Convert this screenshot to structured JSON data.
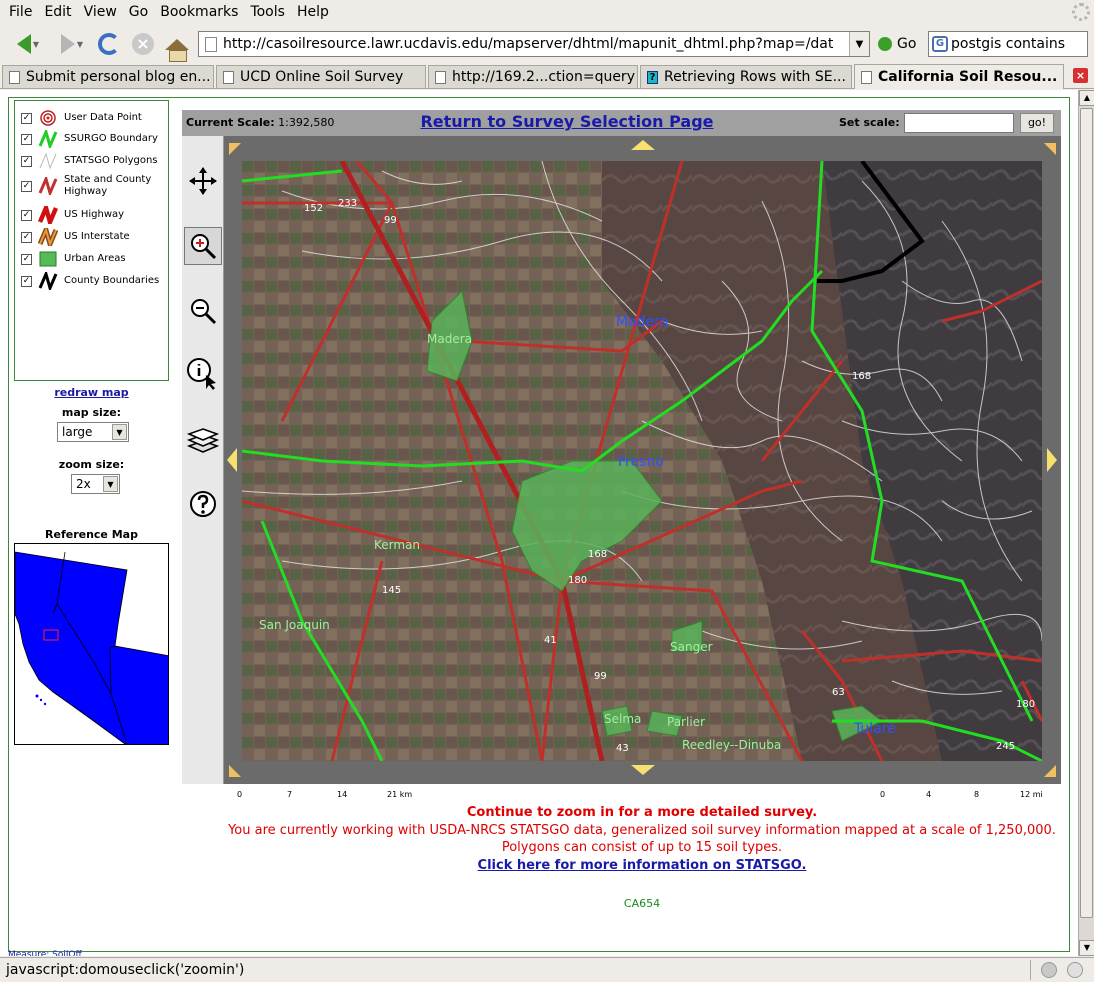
{
  "menubar": {
    "items": [
      "File",
      "Edit",
      "View",
      "Go",
      "Bookmarks",
      "Tools",
      "Help"
    ]
  },
  "navbar": {
    "url": "http://casoilresource.lawr.ucdavis.edu/mapserver/dhtml/mapunit_dhtml.php?map=/dat",
    "go_label": "Go",
    "search_value": "postgis contains"
  },
  "tabs": [
    {
      "label": "Submit personal blog en...",
      "active": false
    },
    {
      "label": "UCD Online Soil Survey",
      "active": false
    },
    {
      "label": "http://169.2...ction=query",
      "active": false
    },
    {
      "label": "Retrieving Rows with SE...",
      "active": false
    },
    {
      "label": "California Soil Resou...",
      "active": true
    }
  ],
  "legend": {
    "items": [
      {
        "label": "User Data Point",
        "checked": true,
        "icon": "target-icon"
      },
      {
        "label": "SSURGO Boundary",
        "checked": true,
        "icon": "green-line-icon"
      },
      {
        "label": "STATSGO Polygons",
        "checked": true,
        "icon": "white-line-icon"
      },
      {
        "label": "State and County Highway",
        "checked": true,
        "icon": "red-line-icon"
      },
      {
        "label": "US Highway",
        "checked": true,
        "icon": "thick-red-line-icon"
      },
      {
        "label": "US Interstate",
        "checked": true,
        "icon": "orange-line-icon"
      },
      {
        "label": "Urban Areas",
        "checked": true,
        "icon": "green-square-icon"
      },
      {
        "label": "County Boundaries",
        "checked": true,
        "icon": "black-line-icon"
      }
    ],
    "redraw_label": "redraw map",
    "map_size_label": "map size:",
    "map_size_value": "large",
    "zoom_size_label": "zoom size:",
    "zoom_size_value": "2x",
    "reference_title": "Reference Map"
  },
  "map": {
    "current_scale_label": "Current Scale:",
    "current_scale_value": "1:392,580",
    "return_link": "Return to Survey Selection Page",
    "set_scale_label": "Set scale:",
    "set_scale_value": "",
    "go_button": "go!",
    "tools": [
      "pan-icon",
      "zoom-in-icon",
      "zoom-out-icon",
      "info-icon",
      "layers-icon",
      "help-icon"
    ],
    "selected_tool": "zoom-in-icon",
    "labels": {
      "madera_city": "Madera",
      "madera_county": "Madera",
      "fresno": "Fresno",
      "kerman": "Kerman",
      "san_joaquin": "San Joaquin",
      "sanger": "Sanger",
      "selma": "Selma",
      "parlier": "Parlier",
      "reedley_dinuba": "Reedley--Dinuba",
      "tulare": "Tulare"
    },
    "route_shields": [
      "152",
      "233",
      "99",
      "168",
      "168",
      "180",
      "145",
      "41",
      "99",
      "43",
      "63",
      "180",
      "245"
    ]
  },
  "scalebar_km": {
    "ticks": [
      "0",
      "7",
      "14",
      "21 km"
    ]
  },
  "scalebar_mi": {
    "ticks": [
      "0",
      "4",
      "8",
      "12 mi"
    ]
  },
  "messages": {
    "zoom_hint": "Continue to zoom in for a more detailed survey.",
    "working_with": "You are currently working with USDA-NRCS STATSGO data, generalized soil survey information mapped at a scale of 1,250,000.",
    "polygons": "Polygons can consist of up to 15 soil types.",
    "more_info": "Click here for more information on STATSGO.",
    "map_code": "CA654"
  },
  "status": {
    "text": "javascript:domouseclick('zoomin')",
    "measure": "Measure: SoilOff"
  }
}
